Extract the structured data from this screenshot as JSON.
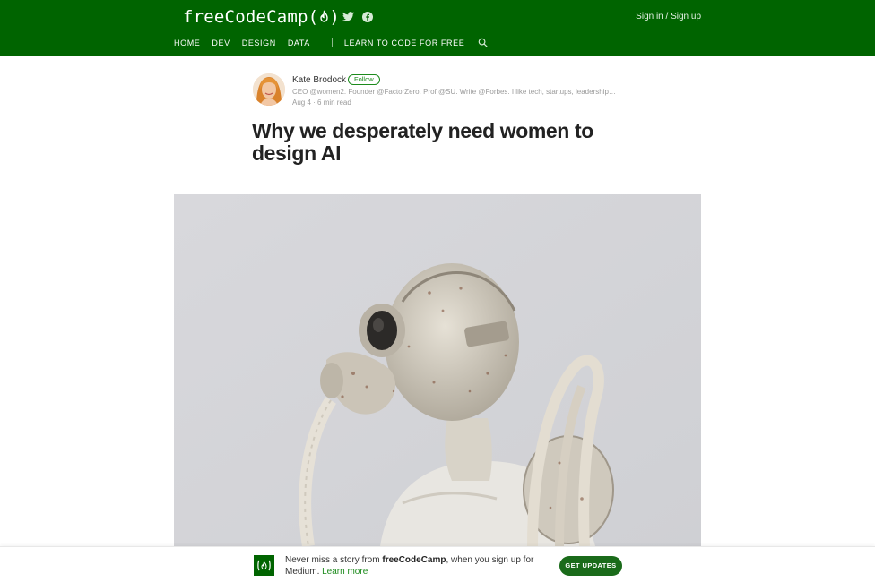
{
  "header": {
    "logo_text": "freeCodeCamp(",
    "logo_mark_close": ")",
    "signin_label": "Sign in / Sign up",
    "social_icons": [
      "twitter-icon",
      "facebook-icon"
    ],
    "nav": [
      {
        "label": "HOME"
      },
      {
        "label": "DEV"
      },
      {
        "label": "DESIGN"
      },
      {
        "label": "DATA"
      }
    ],
    "nav_learn": "LEARN TO CODE FOR FREE",
    "search_icon": "search-icon"
  },
  "author": {
    "name": "Kate Brodock",
    "follow_label": "Follow",
    "bio": "CEO @women2. Founder @FactorZero. Prof @SU. Write @Forbes. I like tech, startups, leadership, …",
    "meta": "Aug 4 · 6 min read"
  },
  "article": {
    "title": "Why we desperately need women to design AI"
  },
  "banner": {
    "text_before": "Never miss a story from ",
    "text_brand": "freeCodeCamp",
    "text_after": ", when you sign up for Medium. ",
    "learn_more": "Learn more",
    "cta_label": "GET UPDATES"
  },
  "colors": {
    "header_bg": "#006400",
    "accent_green": "#1b8a1b",
    "cta_bg": "#1a6b1a"
  }
}
